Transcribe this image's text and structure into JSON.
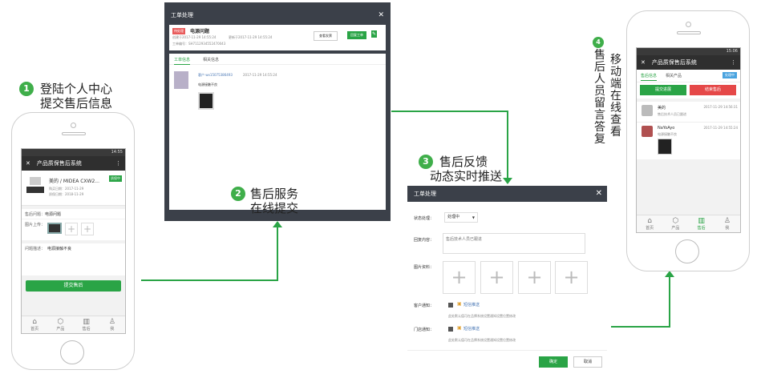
{
  "steps": {
    "s1": {
      "num": "1",
      "line1": "登陆个人中心",
      "line2": "提交售后信息"
    },
    "s2": {
      "num": "2",
      "line1": "售后服务",
      "line2": "在线提交"
    },
    "s3": {
      "num": "3",
      "line1": "售后反馈",
      "line2": "动态实时推送"
    },
    "s4": {
      "num": "4",
      "col1": "售后人员留言答复",
      "col2": "移动端在线查看"
    }
  },
  "phone1": {
    "status": "14:55",
    "title": "产品质保售后系统",
    "back": "✕",
    "menu": "⋮",
    "product_name": "美的 / MIDEA CXW2...",
    "product_tag": "质保中",
    "date1": "购买日期：2017-11-29",
    "date2": "质保日期：2018-11-29",
    "issue_label": "售后问题：",
    "issue_value": "电源问题",
    "image_label": "图片上传：",
    "desc_label": "问题描述：",
    "desc_value": "电源接触不良",
    "submit": "提交售后",
    "nav": [
      "首页",
      "产品",
      "售后",
      "我"
    ]
  },
  "panel2": {
    "title": "工单处理",
    "close": "✕",
    "status_tag": "待处理",
    "issue": "电源问题",
    "created": "创建于2017-11-29 14:55:24",
    "updated": "更新于2017-11-29 14:55:24",
    "order_no": "工单编号：SH7112934552470043",
    "btn1": "查看发票",
    "btn2": "回复工单",
    "tab1": "工单信息",
    "tab2": "相关信息",
    "user": "客户 wx15075386493",
    "time": "2017-11-29 14:55:24",
    "message": "电源接触不良"
  },
  "panel3": {
    "title": "工单处理",
    "close": "✕",
    "status_label": "状态处理：",
    "status_value": "处理中",
    "reply_label": "回复内容：",
    "reply_value": "售后技术人员已跟进",
    "image_label": "图片资料：",
    "notify1_label": "客户通知：",
    "notify1_value": "短信推送",
    "notify1_hint": "此处默认值可在品牌系统设置通知设置位置修改",
    "notify2_label": "门店通知：",
    "notify2_value": "短信推送",
    "notify2_hint": "此处默认值可在品牌系统设置通知设置位置修改",
    "confirm": "确定",
    "cancel": "取消"
  },
  "phone4": {
    "status": "15:06",
    "title": "产品质保售后系统",
    "back": "✕",
    "menu": "⋮",
    "tab1": "售后信息",
    "tab2": "相关产品",
    "tag": "处理中",
    "btn1": "提交进展",
    "btn2": "结束售后",
    "msg1_name": "美的",
    "msg1_time": "2017-11-29 14:56:31",
    "msg1_text": "售后技术人员已跟进",
    "msg2_name": "NaYoAyo",
    "msg2_time": "2017-11-29 14:55:24",
    "msg2_text": "电源接触不良",
    "nav": [
      "首页",
      "产品",
      "售后",
      "我"
    ]
  }
}
